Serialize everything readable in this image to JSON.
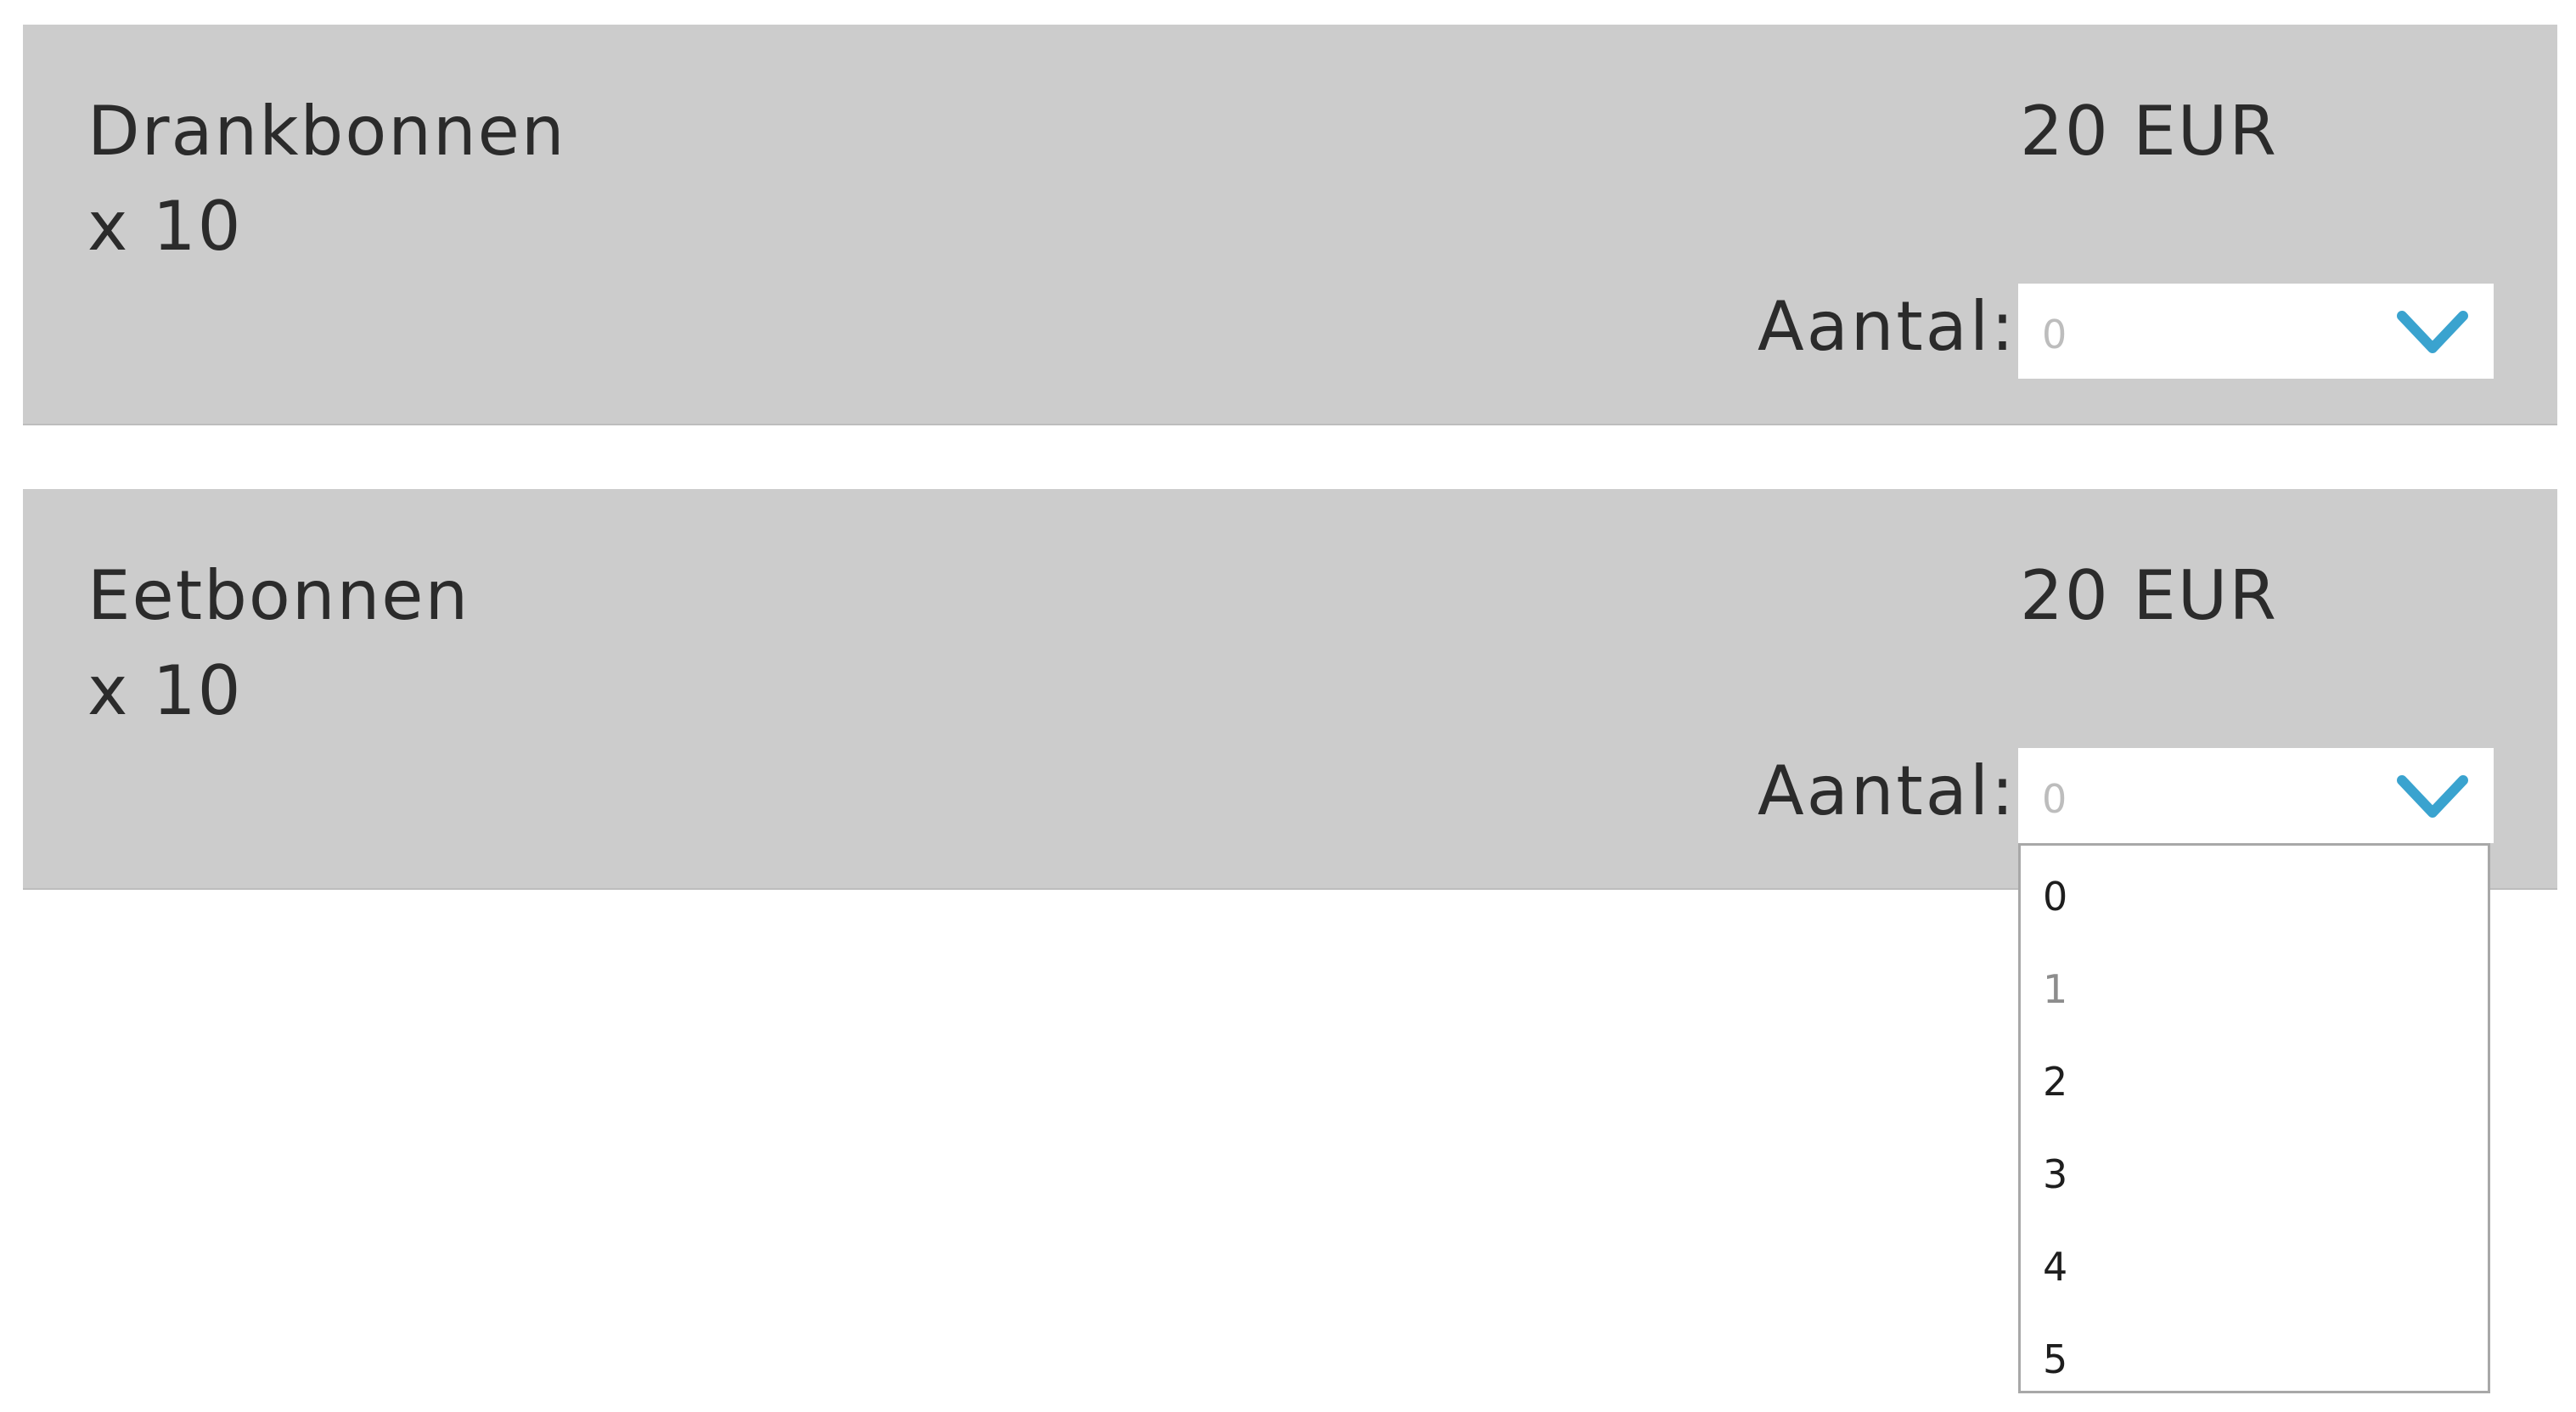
{
  "products": [
    {
      "name": "Drankbonnen",
      "multiplier": "x 10",
      "price": "20 EUR",
      "quantity_label": "Aantal:",
      "selected_quantity": "0"
    },
    {
      "name": "Eetbonnen",
      "multiplier": "x 10",
      "price": "20 EUR",
      "quantity_label": "Aantal:",
      "selected_quantity": "0"
    }
  ],
  "quantity_dropdown": {
    "options": [
      "0",
      "1",
      "2",
      "3",
      "4",
      "5"
    ],
    "highlighted_option": "1"
  },
  "colors": {
    "card_background": "#cccccc",
    "chevron": "#3aa3cf",
    "placeholder_text": "#bdbdbd",
    "dropdown_border": "#a8a8a8"
  },
  "icons": {
    "select_arrow": "chevron-down-icon"
  }
}
